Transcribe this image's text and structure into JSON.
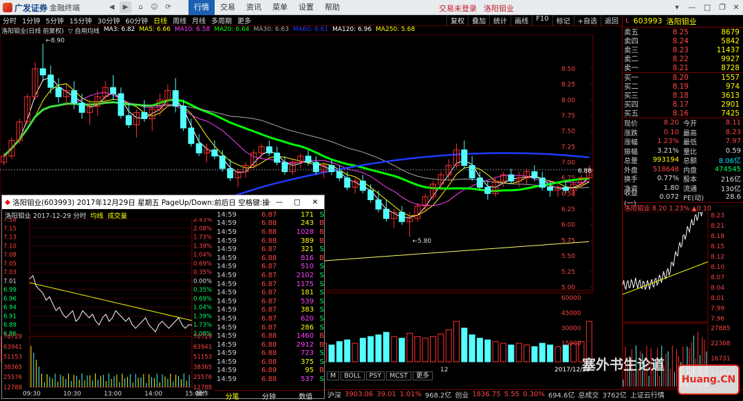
{
  "app": {
    "brand": "广发证券",
    "brand_sub": "金融终端",
    "menus": [
      "行情",
      "交易",
      "资讯",
      "菜单",
      "设置",
      "帮助"
    ],
    "active_menu": "行情",
    "login_status": "交易未登录",
    "stock_title": "洛阳钼业"
  },
  "toolbar": {
    "periods": [
      "分时",
      "1分钟",
      "5分钟",
      "15分钟",
      "30分钟",
      "60分钟",
      "日线",
      "周线",
      "月线",
      "多周期",
      "更多"
    ],
    "selected_period": "日线",
    "tools": [
      "复权",
      "叠加",
      "统计",
      "画线",
      "F10",
      "标记",
      "+自选",
      "返回"
    ]
  },
  "ma_header": {
    "stock": "洛阳钼业(日线 前复权)",
    "indicator": "▽ 自用均线",
    "items": [
      {
        "label": "MA3: 6.82",
        "color": "#ffffff"
      },
      {
        "label": "MA5: 6.66",
        "color": "#ffff00"
      },
      {
        "label": "MA10: 6.58",
        "color": "#ff40ff"
      },
      {
        "label": "MA20: 6.64",
        "color": "#00ff00"
      },
      {
        "label": "MA30: 6.63",
        "color": "#aaaaaa"
      },
      {
        "label": "MA60: 6.61",
        "color": "#1e3cff"
      },
      {
        "label": "MA120: 6.96",
        "color": "#ffffff"
      },
      {
        "label": "MA250: 5.68",
        "color": "#ffff00"
      }
    ]
  },
  "chart_data": {
    "type": "candlestick",
    "y_ticks": [
      "8.50",
      "8.25",
      "8.00",
      "7.75",
      "7.50",
      "7.25",
      "7.00",
      "6.75",
      "6.50",
      "6.25",
      "6.00",
      "5.75",
      "5.50",
      "5.25",
      "5.00"
    ],
    "ylim": [
      4.95,
      9.05
    ],
    "annotations": [
      {
        "text": "8.90",
        "value": 8.9,
        "index": 5
      },
      {
        "text": "5.80",
        "value": 5.8,
        "index": 52
      }
    ],
    "current_price_label": "6.88",
    "vol_ticks": [
      "60000",
      "45000",
      "30000",
      "15000"
    ],
    "x_ticks": [
      "12",
      "2017/12/29"
    ],
    "candles": [
      [
        7.0,
        7.15,
        6.95,
        7.1
      ],
      [
        7.1,
        7.4,
        7.05,
        7.35
      ],
      [
        7.35,
        7.7,
        7.3,
        7.65
      ],
      [
        7.65,
        8.1,
        7.6,
        8.05
      ],
      [
        8.05,
        8.6,
        8.0,
        8.5
      ],
      [
        8.5,
        8.9,
        8.3,
        8.4
      ],
      [
        8.4,
        8.55,
        8.1,
        8.2
      ],
      [
        8.2,
        8.35,
        7.95,
        8.05
      ],
      [
        8.05,
        8.25,
        7.9,
        8.15
      ],
      [
        8.15,
        8.3,
        7.85,
        7.95
      ],
      [
        7.95,
        8.1,
        7.7,
        7.8
      ],
      [
        7.8,
        8.0,
        7.6,
        7.9
      ],
      [
        7.9,
        8.15,
        7.75,
        8.05
      ],
      [
        8.05,
        8.3,
        7.95,
        8.2
      ],
      [
        8.2,
        8.4,
        8.0,
        8.1
      ],
      [
        8.1,
        8.2,
        7.7,
        7.75
      ],
      [
        7.75,
        7.95,
        7.55,
        7.6
      ],
      [
        7.6,
        7.85,
        7.4,
        7.8
      ],
      [
        7.8,
        8.0,
        7.65,
        7.7
      ],
      [
        7.7,
        7.9,
        7.5,
        7.85
      ],
      [
        7.85,
        8.1,
        7.75,
        8.0
      ],
      [
        8.0,
        8.25,
        7.9,
        8.15
      ],
      [
        8.15,
        8.35,
        7.8,
        7.9
      ],
      [
        7.9,
        8.0,
        7.5,
        7.55
      ],
      [
        7.55,
        7.7,
        7.25,
        7.3
      ],
      [
        7.3,
        7.45,
        7.1,
        7.15
      ],
      [
        7.15,
        7.3,
        7.0,
        7.2
      ],
      [
        7.2,
        7.35,
        7.05,
        7.1
      ],
      [
        7.1,
        7.2,
        6.85,
        6.9
      ],
      [
        6.9,
        7.05,
        6.7,
        6.75
      ],
      [
        6.75,
        6.9,
        6.6,
        6.85
      ],
      [
        6.85,
        7.0,
        6.75,
        6.95
      ],
      [
        6.95,
        7.2,
        6.9,
        7.15
      ],
      [
        7.15,
        7.3,
        7.05,
        7.25
      ],
      [
        7.25,
        7.35,
        7.1,
        7.15
      ],
      [
        7.15,
        7.25,
        6.95,
        7.0
      ],
      [
        7.0,
        7.1,
        6.8,
        6.85
      ],
      [
        6.85,
        7.05,
        6.8,
        7.0
      ],
      [
        7.0,
        7.15,
        6.9,
        7.1
      ],
      [
        7.1,
        7.2,
        6.95,
        7.0
      ],
      [
        7.0,
        7.1,
        6.8,
        6.85
      ],
      [
        6.85,
        7.0,
        6.75,
        6.95
      ],
      [
        6.95,
        7.05,
        6.8,
        6.85
      ],
      [
        6.85,
        6.95,
        6.7,
        6.75
      ],
      [
        6.75,
        6.85,
        6.55,
        6.6
      ],
      [
        6.6,
        6.75,
        6.5,
        6.7
      ],
      [
        6.7,
        6.8,
        6.5,
        6.55
      ],
      [
        6.55,
        6.65,
        6.35,
        6.4
      ],
      [
        6.4,
        6.55,
        6.2,
        6.25
      ],
      [
        6.25,
        6.4,
        6.05,
        6.1
      ],
      [
        6.1,
        6.25,
        5.95,
        6.2
      ],
      [
        6.2,
        6.3,
        6.0,
        6.05
      ],
      [
        6.05,
        6.2,
        5.8,
        6.1
      ],
      [
        6.1,
        6.35,
        6.05,
        6.3
      ],
      [
        6.3,
        6.5,
        6.2,
        6.45
      ],
      [
        6.45,
        6.7,
        6.4,
        6.65
      ],
      [
        6.65,
        6.85,
        6.55,
        6.8
      ],
      [
        6.8,
        7.05,
        6.7,
        6.95
      ],
      [
        6.95,
        7.3,
        6.9,
        7.2
      ],
      [
        7.2,
        7.35,
        6.9,
        6.95
      ],
      [
        6.95,
        7.1,
        6.7,
        6.75
      ],
      [
        6.75,
        6.85,
        6.55,
        6.6
      ],
      [
        6.6,
        6.7,
        6.4,
        6.5
      ],
      [
        6.5,
        6.75,
        6.45,
        6.7
      ],
      [
        6.7,
        6.85,
        6.6,
        6.8
      ],
      [
        6.8,
        6.9,
        6.65,
        6.7
      ],
      [
        6.7,
        6.85,
        6.6,
        6.75
      ],
      [
        6.75,
        6.9,
        6.65,
        6.85
      ],
      [
        6.85,
        6.95,
        6.7,
        6.75
      ],
      [
        6.75,
        6.85,
        6.55,
        6.6
      ],
      [
        6.6,
        6.7,
        6.45,
        6.55
      ],
      [
        6.55,
        6.65,
        6.45,
        6.6
      ],
      [
        6.6,
        6.7,
        6.5,
        6.55
      ],
      [
        6.55,
        6.7,
        6.45,
        6.65
      ],
      [
        6.65,
        6.8,
        6.6,
        6.75
      ],
      [
        6.75,
        6.95,
        6.7,
        6.88
      ]
    ],
    "volumes": [
      30,
      42,
      55,
      60,
      72,
      65,
      48,
      40,
      38,
      35,
      30,
      28,
      33,
      36,
      31,
      40,
      35,
      30,
      28,
      26,
      30,
      32,
      38,
      42,
      36,
      30,
      25,
      22,
      30,
      33,
      28,
      24,
      30,
      26,
      22,
      24,
      20,
      18,
      22,
      20,
      18,
      22,
      20,
      24,
      26,
      22,
      28,
      30,
      32,
      35,
      30,
      28,
      34,
      30,
      28,
      30,
      33,
      38,
      48,
      40,
      32,
      28,
      26,
      24,
      22,
      20,
      22,
      20,
      18,
      22,
      20,
      18,
      20,
      22,
      24,
      48
    ]
  },
  "subtabs": [
    "M",
    "BOLL",
    "PSY",
    "MCST",
    "更多"
  ],
  "quote": {
    "code": "603993",
    "name": "洛阳钼业",
    "asks": [
      {
        "label": "卖五",
        "price": "8.25",
        "vol": "8679"
      },
      {
        "label": "卖四",
        "price": "8.24",
        "vol": "5842"
      },
      {
        "label": "卖三",
        "price": "8.23",
        "vol": "11437"
      },
      {
        "label": "卖二",
        "price": "8.22",
        "vol": "9927"
      },
      {
        "label": "卖一",
        "price": "8.21",
        "vol": "8728"
      }
    ],
    "bids": [
      {
        "label": "买一",
        "price": "8.20",
        "vol": "1557"
      },
      {
        "label": "买二",
        "price": "8.19",
        "vol": "974"
      },
      {
        "label": "买三",
        "price": "8.18",
        "vol": "3613"
      },
      {
        "label": "买四",
        "price": "8.17",
        "vol": "2901"
      },
      {
        "label": "买五",
        "price": "8.16",
        "vol": "7425"
      }
    ],
    "stats": [
      {
        "k": "现价",
        "v": "8.20",
        "k2": "今开",
        "v2": "8.11"
      },
      {
        "k": "涨跌",
        "v": "0.10",
        "k2": "最高",
        "v2": "8.23"
      },
      {
        "k": "涨幅",
        "v": "1.23%",
        "k2": "最低",
        "v2": "7.97"
      },
      {
        "k": "振幅",
        "v": "3.21%",
        "k2": "量比",
        "v2": "0.59"
      },
      {
        "k": "总量",
        "v": "993194",
        "k2": "总额",
        "v2": "8.06亿"
      },
      {
        "k": "外盘",
        "v": "518648",
        "k2": "内盘",
        "v2": "474545"
      },
      {
        "k": "换手",
        "v": "0.77%",
        "k2": "股本",
        "v2": "216亿"
      },
      {
        "k": "净资",
        "v": "1.80",
        "k2": "流通",
        "v2": "130亿"
      },
      {
        "k": "收益(一)",
        "v": "0.072",
        "k2": "PE(动)",
        "v2": "28.6"
      }
    ],
    "mini_header": "洛阳钼业  8.20  1.23%  ▲0.10",
    "mini_right_ticks": [
      "8.23",
      "8.21",
      "8.18",
      "8.15",
      "8.12",
      "8.10",
      "8.07",
      "8.04",
      "8.01",
      "7.99",
      "7.96"
    ],
    "mini_vol_ticks": [
      "27885",
      "22308",
      "16731",
      "11154"
    ]
  },
  "popup": {
    "title": "洛阳钼业(603993) 2017年12月29日 星期五 PageUp/Down:前后日 空格键:操作 通达信(R)",
    "subheader": "洛阳钼业   2017-12-29 分时",
    "legend": [
      "均线",
      "成交量"
    ],
    "left_ticks": [
      "7.18",
      "7.15",
      "7.13",
      "7.10",
      "7.08",
      "7.05",
      "7.03",
      "7.01",
      "6.99",
      "6.96",
      "6.94",
      "6.91",
      "6.89",
      "6.86",
      "76729",
      "63941",
      "51153",
      "38365",
      "25576",
      "12788"
    ],
    "right_ticks": [
      "2.43%",
      "2.08%",
      "1.73%",
      "1.39%",
      "1.04%",
      "0.69%",
      "0.35%",
      "0.00%",
      "0.35%",
      "0.69%",
      "1.04%",
      "1.39%",
      "1.73%",
      "2.08%",
      "76729",
      "63941",
      "51153",
      "38365",
      "25576",
      "12788"
    ],
    "time_labels": [
      "09:30",
      "10:30",
      "13:00",
      "14:00",
      "15:00"
    ],
    "op_label": "操作",
    "tabs": [
      "分笔",
      "分钟",
      "数值"
    ],
    "ticks": [
      {
        "t": "14:59",
        "p": "6.87",
        "q": "171",
        "s": "S"
      },
      {
        "t": "14:59",
        "p": "6.88",
        "q": "243",
        "s": "B"
      },
      {
        "t": "14:59",
        "p": "6.88",
        "q": "1028",
        "s": "B"
      },
      {
        "t": "14:59",
        "p": "6.88",
        "q": "389",
        "s": "B"
      },
      {
        "t": "14:59",
        "p": "6.87",
        "q": "321",
        "s": "S"
      },
      {
        "t": "14:59",
        "p": "6.88",
        "q": "816",
        "s": "B"
      },
      {
        "t": "14:59",
        "p": "6.87",
        "q": "510",
        "s": "S"
      },
      {
        "t": "14:59",
        "p": "6.87",
        "q": "2102",
        "s": "S"
      },
      {
        "t": "14:59",
        "p": "6.87",
        "q": "1175",
        "s": "S"
      },
      {
        "t": "14:59",
        "p": "6.87",
        "q": "181",
        "s": "S"
      },
      {
        "t": "14:59",
        "p": "6.87",
        "q": "539",
        "s": "S"
      },
      {
        "t": "14:59",
        "p": "6.87",
        "q": "383",
        "s": "S"
      },
      {
        "t": "14:59",
        "p": "6.87",
        "q": "620",
        "s": "S"
      },
      {
        "t": "14:59",
        "p": "6.87",
        "q": "286",
        "s": "S"
      },
      {
        "t": "14:59",
        "p": "6.88",
        "q": "1460",
        "s": "B"
      },
      {
        "t": "14:59",
        "p": "6.88",
        "q": "2912",
        "s": "B"
      },
      {
        "t": "14:59",
        "p": "6.88",
        "q": "723",
        "s": "S"
      },
      {
        "t": "14:59",
        "p": "6.88",
        "q": "375",
        "s": "S"
      },
      {
        "t": "14:59",
        "p": "6.89",
        "q": "95",
        "s": "B"
      },
      {
        "t": "14:59",
        "p": "6.88",
        "q": "537",
        "s": "S"
      }
    ],
    "intraday": [
      7.01,
      7.02,
      6.99,
      6.98,
      6.97,
      6.95,
      6.96,
      6.94,
      6.92,
      6.93,
      6.91,
      6.9,
      6.91,
      6.92,
      6.89,
      6.9,
      6.92,
      6.91,
      6.9,
      6.91,
      6.89,
      6.88,
      6.9,
      6.91,
      6.89,
      6.9,
      6.92,
      6.91,
      6.9,
      6.89,
      6.9,
      6.88,
      6.87,
      6.88,
      6.89,
      6.9,
      6.88,
      6.87,
      6.86,
      6.88,
      6.89,
      6.88,
      6.87,
      6.88,
      6.89,
      6.9,
      6.88,
      6.87,
      6.88,
      6.88
    ]
  },
  "statusbar": {
    "items": [
      {
        "text": "沪深",
        "color": "#cccccc"
      },
      {
        "text": "3903.06",
        "color": "#ff4444"
      },
      {
        "text": "39.01",
        "color": "#ff4444"
      },
      {
        "text": "1.01%",
        "color": "#ff4444"
      },
      {
        "text": "968.2亿",
        "color": "#cccccc"
      },
      {
        "text": "创业",
        "color": "#cccccc"
      },
      {
        "text": "1836.75",
        "color": "#ff4444"
      },
      {
        "text": "5.55",
        "color": "#ff4444"
      },
      {
        "text": "0.30%",
        "color": "#ff4444"
      },
      {
        "text": "694.6亿",
        "color": "#cccccc"
      },
      {
        "text": "总成交",
        "color": "#cccccc"
      },
      {
        "text": "3762亿",
        "color": "#cccccc"
      },
      {
        "text": "上证云行情",
        "color": "#cccccc"
      }
    ]
  },
  "watermark": {
    "text": "塞外书生论道",
    "logo": "Huang.CN"
  },
  "colors": {
    "up": "#ff3030",
    "down": "#54ffff",
    "accent": "#1d5fb3"
  }
}
